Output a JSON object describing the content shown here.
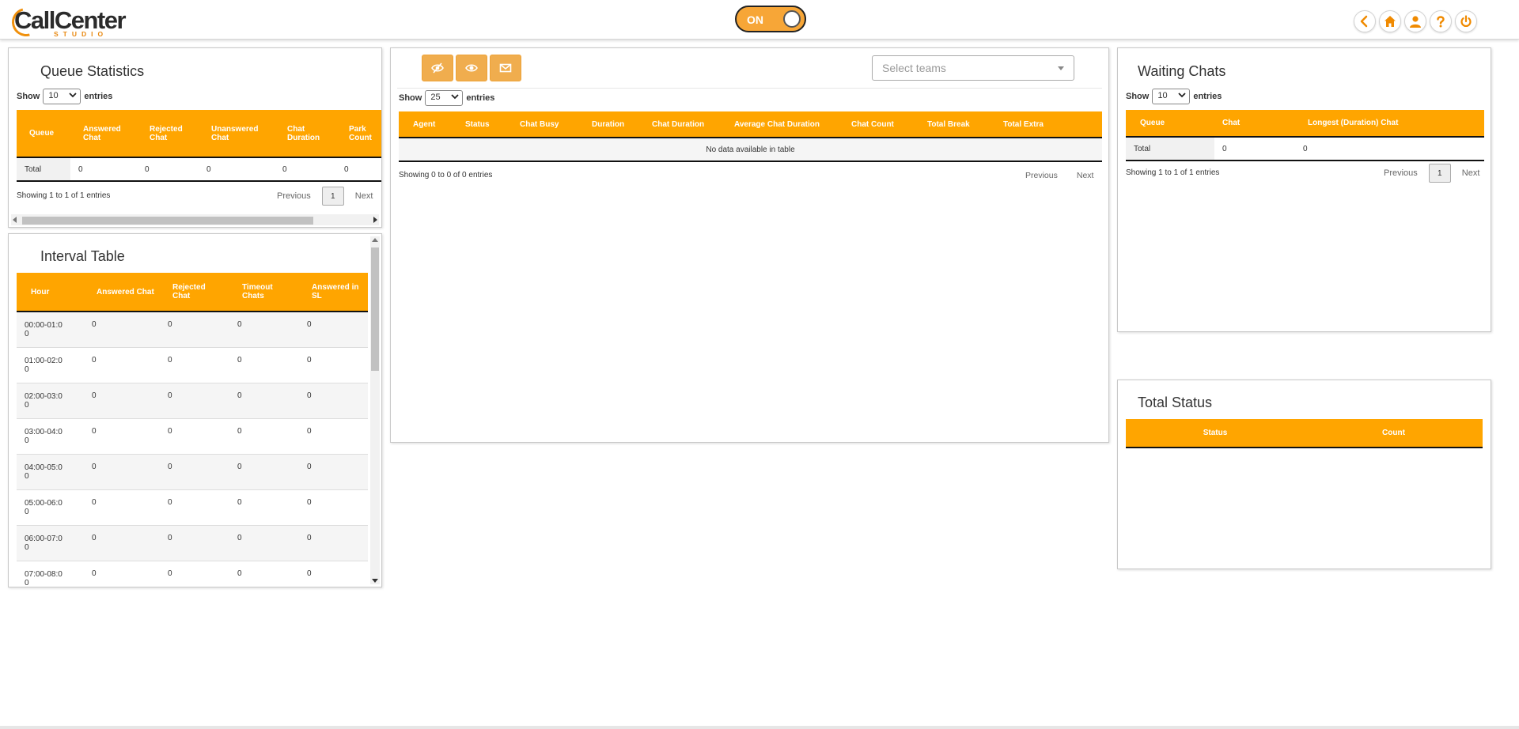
{
  "header": {
    "logo_main": "CallCenter",
    "logo_sub": "STUDIO",
    "toggle_label": "ON",
    "icons": [
      "back-icon",
      "home-icon",
      "user-icon",
      "help-icon",
      "power-icon"
    ]
  },
  "colors": {
    "accent": "#ffa500",
    "button": "#f0ad4e",
    "toggle": "#f7a637"
  },
  "queue_stats": {
    "title": "Queue Statistics",
    "show_label": "Show",
    "entries_value": "10",
    "entries_label": "entries",
    "columns": [
      "Queue",
      "Answered Chat",
      "Rejected Chat",
      "Unanswered Chat",
      "Chat Duration",
      "Park Count"
    ],
    "rows": [
      [
        "Total",
        "0",
        "0",
        "0",
        "0",
        "0"
      ]
    ],
    "info": "Showing 1 to 1 of 1 entries",
    "prev": "Previous",
    "page": "1",
    "next": "Next"
  },
  "interval_table": {
    "title": "Interval Table",
    "columns": [
      "Hour",
      "Answered Chat",
      "Rejected Chat",
      "Timeout Chats",
      "Answered in SL"
    ],
    "rows": [
      [
        "00:00-01:00",
        "0",
        "0",
        "0",
        "0"
      ],
      [
        "01:00-02:00",
        "0",
        "0",
        "0",
        "0"
      ],
      [
        "02:00-03:00",
        "0",
        "0",
        "0",
        "0"
      ],
      [
        "03:00-04:00",
        "0",
        "0",
        "0",
        "0"
      ],
      [
        "04:00-05:00",
        "0",
        "0",
        "0",
        "0"
      ],
      [
        "05:00-06:00",
        "0",
        "0",
        "0",
        "0"
      ],
      [
        "06:00-07:00",
        "0",
        "0",
        "0",
        "0"
      ],
      [
        "07:00-08:00",
        "0",
        "0",
        "0",
        "0"
      ]
    ]
  },
  "agents": {
    "buttons": [
      "eye-off-icon",
      "eye-icon",
      "mail-icon"
    ],
    "teams_placeholder": "Select teams",
    "show_label": "Show",
    "entries_value": "25",
    "entries_label": "entries",
    "columns": [
      "Agent",
      "Status",
      "Chat Busy",
      "Duration",
      "Chat Duration",
      "Average Chat Duration",
      "Chat Count",
      "Total Break",
      "Total Extra"
    ],
    "empty": "No data available in table",
    "info": "Showing 0 to 0 of 0 entries",
    "prev": "Previous",
    "next": "Next"
  },
  "waiting_chats": {
    "title": "Waiting Chats",
    "show_label": "Show",
    "entries_value": "10",
    "entries_label": "entries",
    "columns": [
      "Queue",
      "Chat",
      "Longest (Duration) Chat"
    ],
    "rows": [
      [
        "Total",
        "0",
        "0"
      ]
    ],
    "info": "Showing 1 to 1 of 1 entries",
    "prev": "Previous",
    "page": "1",
    "next": "Next"
  },
  "total_status": {
    "title": "Total Status",
    "columns": [
      "Status",
      "Count"
    ]
  }
}
